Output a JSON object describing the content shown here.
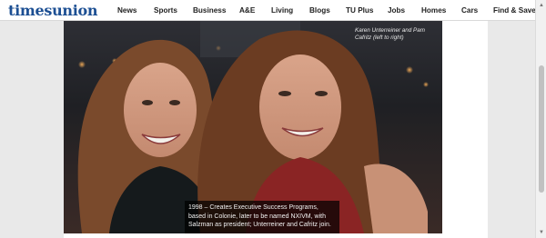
{
  "header": {
    "logo": "timesunion",
    "nav": [
      "News",
      "Sports",
      "Business",
      "A&E",
      "Living",
      "Blogs",
      "TU Plus",
      "Jobs",
      "Homes",
      "Cars",
      "Find & Save"
    ]
  },
  "photo": {
    "credit": "Karen Unterreiner and Pam Cafritz (left to right)",
    "caption": "1998 – Creates Executive Success Programs, based in Colonie, later to be named NXIVM, with Salzman as president; Unterreiner and Cafritz join."
  },
  "colors": {
    "logo": "#1c4f93",
    "caption_bg": "#000000"
  }
}
